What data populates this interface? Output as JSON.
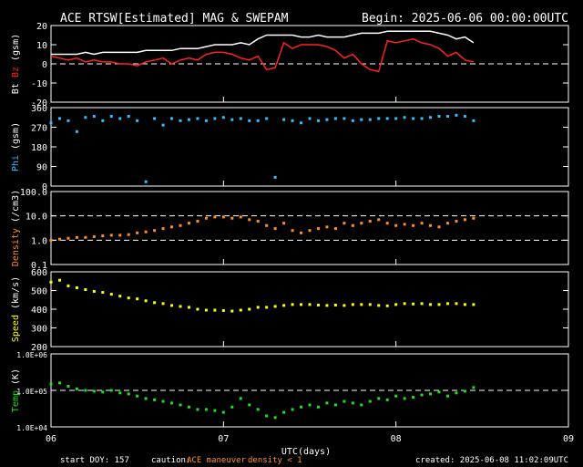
{
  "header": {
    "title": "ACE RTSW[Estimated] MAG & SWEPAM",
    "begin": "Begin: 2025-06-06 00:00:00UTC"
  },
  "footer": {
    "start_doy": "start DOY: 157",
    "caution_label": "caution:",
    "caution_maneuver": "ACE maneuver",
    "caution_density": "density < 1",
    "created": "created: 2025-06-08 11:02:09UTC"
  },
  "colors": {
    "bt": "#ffffff",
    "bz": "#ff2020",
    "phi": "#30c0ff",
    "density": "#ff9020",
    "speed": "#ffff00",
    "temp": "#20e020",
    "axis": "#ffffff",
    "background": "#000000"
  },
  "chart_data": [
    {
      "type": "line",
      "name": "mag",
      "ylabel": [
        "Bt",
        "Bz",
        "(gsm)"
      ],
      "ylim": [
        -20,
        20
      ],
      "yticks": [
        "20",
        "10",
        "0",
        "-10",
        "-20"
      ],
      "reference_lines": [
        0
      ],
      "x": [
        0.0,
        0.05,
        0.1,
        0.15,
        0.2,
        0.25,
        0.3,
        0.35,
        0.4,
        0.45,
        0.5,
        0.55,
        0.6,
        0.65,
        0.7,
        0.75,
        0.8,
        0.85,
        0.9,
        0.95,
        1.0,
        1.05,
        1.1,
        1.15,
        1.2,
        1.25,
        1.3,
        1.35,
        1.4,
        1.45,
        1.5,
        1.55,
        1.6,
        1.65,
        1.7,
        1.75,
        1.8,
        1.85,
        1.9,
        1.95,
        2.0,
        2.05,
        2.1,
        2.15,
        2.2,
        2.25,
        2.3,
        2.35,
        2.4,
        2.45
      ],
      "series": [
        {
          "name": "Bt",
          "values": [
            5,
            5,
            5,
            5,
            6,
            5,
            6,
            6,
            6,
            6,
            6,
            7,
            7,
            7,
            7,
            8,
            8,
            8,
            9,
            10,
            10,
            10,
            11,
            10,
            13,
            15,
            15,
            15,
            15,
            14,
            14,
            15,
            14,
            14,
            14,
            15,
            16,
            16,
            16,
            17,
            17,
            17,
            17,
            17,
            17,
            16,
            15,
            13,
            14,
            11
          ]
        },
        {
          "name": "Bz",
          "values": [
            4,
            3,
            2,
            3,
            1,
            2,
            1,
            1,
            0,
            0,
            -1,
            1,
            2,
            3,
            0,
            2,
            3,
            2,
            5,
            6,
            6,
            5,
            3,
            2,
            4,
            -3,
            -2,
            11,
            8,
            10,
            10,
            10,
            9,
            7,
            3,
            5,
            0,
            -3,
            -4,
            12,
            11,
            12,
            13,
            11,
            10,
            8,
            4,
            6,
            2,
            1
          ]
        }
      ]
    },
    {
      "type": "scatter",
      "name": "phi",
      "ylabel": [
        "Phi",
        "(gsm)"
      ],
      "ylim": [
        0,
        360
      ],
      "yticks": [
        "360",
        "270",
        "180",
        "90",
        "0"
      ],
      "x": [
        0.0,
        0.05,
        0.1,
        0.15,
        0.2,
        0.25,
        0.3,
        0.35,
        0.4,
        0.45,
        0.5,
        0.55,
        0.6,
        0.65,
        0.7,
        0.75,
        0.8,
        0.85,
        0.9,
        0.95,
        1.0,
        1.05,
        1.1,
        1.15,
        1.2,
        1.25,
        1.3,
        1.35,
        1.4,
        1.45,
        1.5,
        1.55,
        1.6,
        1.65,
        1.7,
        1.75,
        1.8,
        1.85,
        1.9,
        1.95,
        2.0,
        2.05,
        2.1,
        2.15,
        2.2,
        2.25,
        2.3,
        2.35,
        2.4,
        2.45
      ],
      "series": [
        {
          "name": "Phi",
          "values": [
            290,
            310,
            300,
            250,
            315,
            320,
            300,
            320,
            310,
            320,
            300,
            20,
            310,
            280,
            310,
            300,
            305,
            310,
            300,
            310,
            315,
            305,
            310,
            300,
            300,
            310,
            40,
            305,
            300,
            290,
            310,
            300,
            305,
            310,
            310,
            300,
            305,
            305,
            310,
            310,
            310,
            315,
            310,
            310,
            315,
            320,
            320,
            325,
            320,
            300
          ]
        }
      ]
    },
    {
      "type": "scatter",
      "name": "density",
      "ylabel": [
        "Density",
        "(/cm3)"
      ],
      "scale": "log",
      "ylim": [
        0.1,
        100
      ],
      "yticks": [
        "100.0",
        "10.0",
        "1.0",
        "0.1"
      ],
      "reference_lines": [
        1,
        10
      ],
      "x": [
        0.0,
        0.05,
        0.1,
        0.15,
        0.2,
        0.25,
        0.3,
        0.35,
        0.4,
        0.45,
        0.5,
        0.55,
        0.6,
        0.65,
        0.7,
        0.75,
        0.8,
        0.85,
        0.9,
        0.95,
        1.0,
        1.05,
        1.1,
        1.15,
        1.2,
        1.25,
        1.3,
        1.35,
        1.4,
        1.45,
        1.5,
        1.55,
        1.6,
        1.65,
        1.7,
        1.75,
        1.8,
        1.85,
        1.9,
        1.95,
        2.0,
        2.05,
        2.1,
        2.15,
        2.2,
        2.25,
        2.3,
        2.35,
        2.4,
        2.45
      ],
      "series": [
        {
          "name": "Density",
          "values": [
            1.0,
            1.1,
            1.2,
            1.3,
            1.3,
            1.4,
            1.5,
            1.6,
            1.6,
            1.7,
            2.0,
            2.2,
            2.5,
            3.0,
            3.5,
            4.0,
            5.0,
            6.0,
            8.0,
            9.0,
            9.0,
            8.0,
            9.0,
            7.0,
            6.0,
            4.0,
            3.0,
            5.0,
            2.5,
            2.0,
            2.5,
            3.0,
            3.5,
            3.0,
            5.0,
            4.0,
            5.0,
            6.0,
            7.0,
            5.0,
            4.0,
            4.5,
            4.0,
            5.0,
            4.0,
            3.5,
            5.0,
            6.0,
            7.0,
            8.0
          ]
        }
      ]
    },
    {
      "type": "scatter",
      "name": "speed",
      "ylabel": [
        "Speed",
        "(km/s)"
      ],
      "ylim": [
        200,
        600
      ],
      "yticks": [
        "600",
        "500",
        "400",
        "300",
        "200"
      ],
      "x": [
        0.0,
        0.05,
        0.1,
        0.15,
        0.2,
        0.25,
        0.3,
        0.35,
        0.4,
        0.45,
        0.5,
        0.55,
        0.6,
        0.65,
        0.7,
        0.75,
        0.8,
        0.85,
        0.9,
        0.95,
        1.0,
        1.05,
        1.1,
        1.15,
        1.2,
        1.25,
        1.3,
        1.35,
        1.4,
        1.45,
        1.5,
        1.55,
        1.6,
        1.65,
        1.7,
        1.75,
        1.8,
        1.85,
        1.9,
        1.95,
        2.0,
        2.05,
        2.1,
        2.15,
        2.2,
        2.25,
        2.3,
        2.35,
        2.4,
        2.45
      ],
      "series": [
        {
          "name": "Speed",
          "values": [
            545,
            555,
            525,
            515,
            505,
            495,
            490,
            480,
            470,
            460,
            455,
            445,
            435,
            430,
            420,
            415,
            410,
            400,
            395,
            395,
            393,
            390,
            395,
            400,
            410,
            410,
            415,
            420,
            425,
            425,
            425,
            422,
            420,
            422,
            420,
            425,
            425,
            425,
            420,
            418,
            425,
            430,
            428,
            430,
            425,
            425,
            430,
            430,
            425,
            425
          ]
        }
      ]
    },
    {
      "type": "scatter",
      "name": "temp",
      "ylabel": [
        "Temp",
        "(K)"
      ],
      "scale": "log",
      "ylim": [
        10000,
        1000000
      ],
      "yticks": [
        "1.0E+06",
        "1.0E+05",
        "1.0E+04"
      ],
      "reference_lines": [
        100000
      ],
      "xlabel": "UTC(days)",
      "xticks": [
        "06",
        "07",
        "08",
        "09"
      ],
      "xlim": [
        0,
        3
      ],
      "x": [
        0.0,
        0.05,
        0.1,
        0.15,
        0.2,
        0.25,
        0.3,
        0.35,
        0.4,
        0.45,
        0.5,
        0.55,
        0.6,
        0.65,
        0.7,
        0.75,
        0.8,
        0.85,
        0.9,
        0.95,
        1.0,
        1.05,
        1.1,
        1.15,
        1.2,
        1.25,
        1.3,
        1.35,
        1.4,
        1.45,
        1.5,
        1.55,
        1.6,
        1.65,
        1.7,
        1.75,
        1.8,
        1.85,
        1.9,
        1.95,
        2.0,
        2.05,
        2.1,
        2.15,
        2.2,
        2.25,
        2.3,
        2.35,
        2.4,
        2.45
      ],
      "series": [
        {
          "name": "Temp",
          "values": [
            150000,
            160000,
            130000,
            110000,
            100000,
            95000,
            90000,
            100000,
            85000,
            80000,
            70000,
            60000,
            55000,
            50000,
            45000,
            40000,
            35000,
            30000,
            30000,
            28000,
            25000,
            35000,
            60000,
            40000,
            30000,
            20000,
            18000,
            25000,
            30000,
            35000,
            40000,
            35000,
            45000,
            40000,
            50000,
            45000,
            40000,
            50000,
            60000,
            55000,
            70000,
            60000,
            65000,
            75000,
            80000,
            90000,
            70000,
            85000,
            95000,
            120000
          ]
        }
      ]
    }
  ]
}
